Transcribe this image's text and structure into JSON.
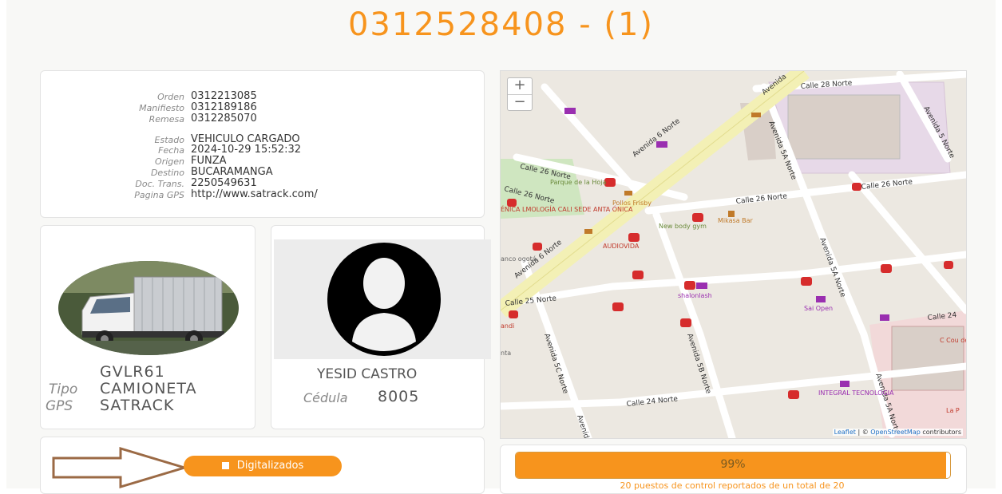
{
  "header": {
    "title": "0312528408 - (1)"
  },
  "info": {
    "rows": [
      {
        "label": "Orden",
        "value": "0312213085"
      },
      {
        "label": "Manifiesto",
        "value": "0312189186"
      },
      {
        "label": "Remesa",
        "value": "0312285070"
      },
      {
        "label": "Estado",
        "value": "VEHICULO CARGADO"
      },
      {
        "label": "Fecha",
        "value": "2024-10-29 15:52:32"
      },
      {
        "label": "Origen",
        "value": "FUNZA"
      },
      {
        "label": "Destino",
        "value": "BUCARAMANGA"
      },
      {
        "label": "Doc. Trans.",
        "value": "2250549631"
      },
      {
        "label": "Pagina GPS",
        "value": "http://www.satrack.com/"
      }
    ]
  },
  "vehicle": {
    "plate": "GVLR61",
    "tipo_label": "Tipo",
    "tipo": "CAMIONETA",
    "gps_label": "GPS",
    "gps": "SATRACK"
  },
  "driver": {
    "name": "YESID CASTRO",
    "cedula_label": "Cédula",
    "cedula": "8005"
  },
  "documents": {
    "button_label": "Digitalizados"
  },
  "map": {
    "zoom_in": "+",
    "zoom_out": "−",
    "labels": {
      "calle_28": "Calle 28 Norte",
      "calle_26a": "Calle 26 Norte",
      "calle_26b": "Calle 26 Norte",
      "calle_26c": "Calle 26 Norte",
      "calle_26d": "Calle 26 Norte",
      "calle_25": "Calle 25 Norte",
      "calle_24": "Calle 24 Norte",
      "calle_24b": "Calle 24",
      "av6a": "Avenida 6 Norte",
      "av6b": "Avenida 6 Norte",
      "av6c": "Avenida",
      "av5a_top": "Avenida 5A Norte",
      "av5a_mid": "Avenida 5A Norte",
      "av5a_bot": "Avenida 5A Norte",
      "av5b": "Avenida 5B Norte",
      "av5c": "Avenida 5C Norte",
      "av5n": "Avenida 5 Norte",
      "av_bottom": "Avenida",
      "parque": "Parque de la Hoja",
      "pollos": "Pollos Frisby",
      "mikasa": "Mikasa Bar",
      "audiovida": "AUDIOVIDA",
      "newbody": "New body gym",
      "shalon": "shalonlash",
      "saiopen": "Sai Open",
      "integral": "INTEGRAL TECNOLOGIA",
      "clinic": "ÉNICA LMOLOGÍA CALI SEDE ANTA ÓNICA",
      "banco": "anco ogotá",
      "andi": "andi",
      "pta": "nta",
      "cou": "C Cou de",
      "lap": "La P"
    },
    "attribution_leaflet": "Leaflet",
    "attribution_sep": " | © ",
    "attribution_osm": "OpenStreetMap",
    "attribution_rest": " contributors"
  },
  "progress": {
    "percent": 99,
    "label": "99%",
    "note": "20 puestos de control reportados de un total de 20"
  },
  "colors": {
    "accent": "#f7941d",
    "street": "#ffffff",
    "avenue": "#f3f0b5",
    "park": "#cfe6c0",
    "landuse": "#e7d9e8"
  }
}
